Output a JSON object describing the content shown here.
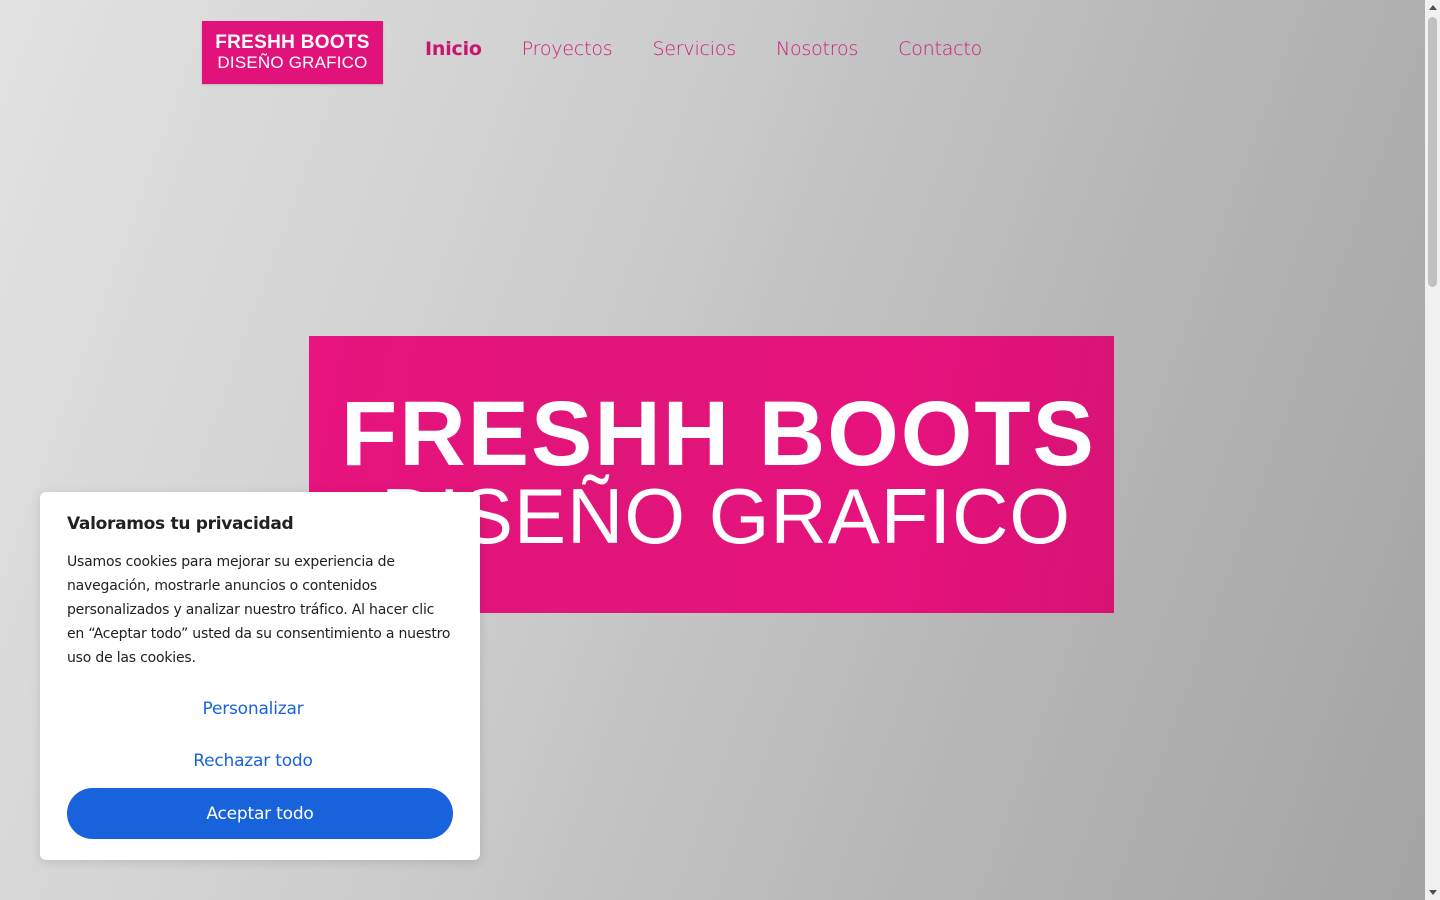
{
  "header": {
    "logo": {
      "line1": "FRESHH BOOTS",
      "line2": "DISEÑO GRAFICO"
    },
    "nav": [
      {
        "label": "Inicio",
        "active": true
      },
      {
        "label": "Proyectos",
        "active": false
      },
      {
        "label": "Servicios",
        "active": false
      },
      {
        "label": "Nosotros",
        "active": false
      },
      {
        "label": "Contacto",
        "active": false
      }
    ]
  },
  "hero": {
    "line1": "FRESHH BOOTS",
    "line2": "DISEÑO GRAFICO"
  },
  "cookie_banner": {
    "title": "Valoramos tu privacidad",
    "text": "Usamos cookies para mejorar su experiencia de navegación, mostrarle anuncios o contenidos personalizados y analizar nuestro tráfico. Al hacer clic en “Aceptar todo” usted da su consentimiento a nuestro uso de las cookies.",
    "customize_label": "Personalizar",
    "reject_label": "Rechazar todo",
    "accept_label": "Aceptar todo"
  },
  "colors": {
    "brand_pink": "#e2127b",
    "nav_pink": "#d11a7c",
    "accept_blue": "#1863dc"
  }
}
